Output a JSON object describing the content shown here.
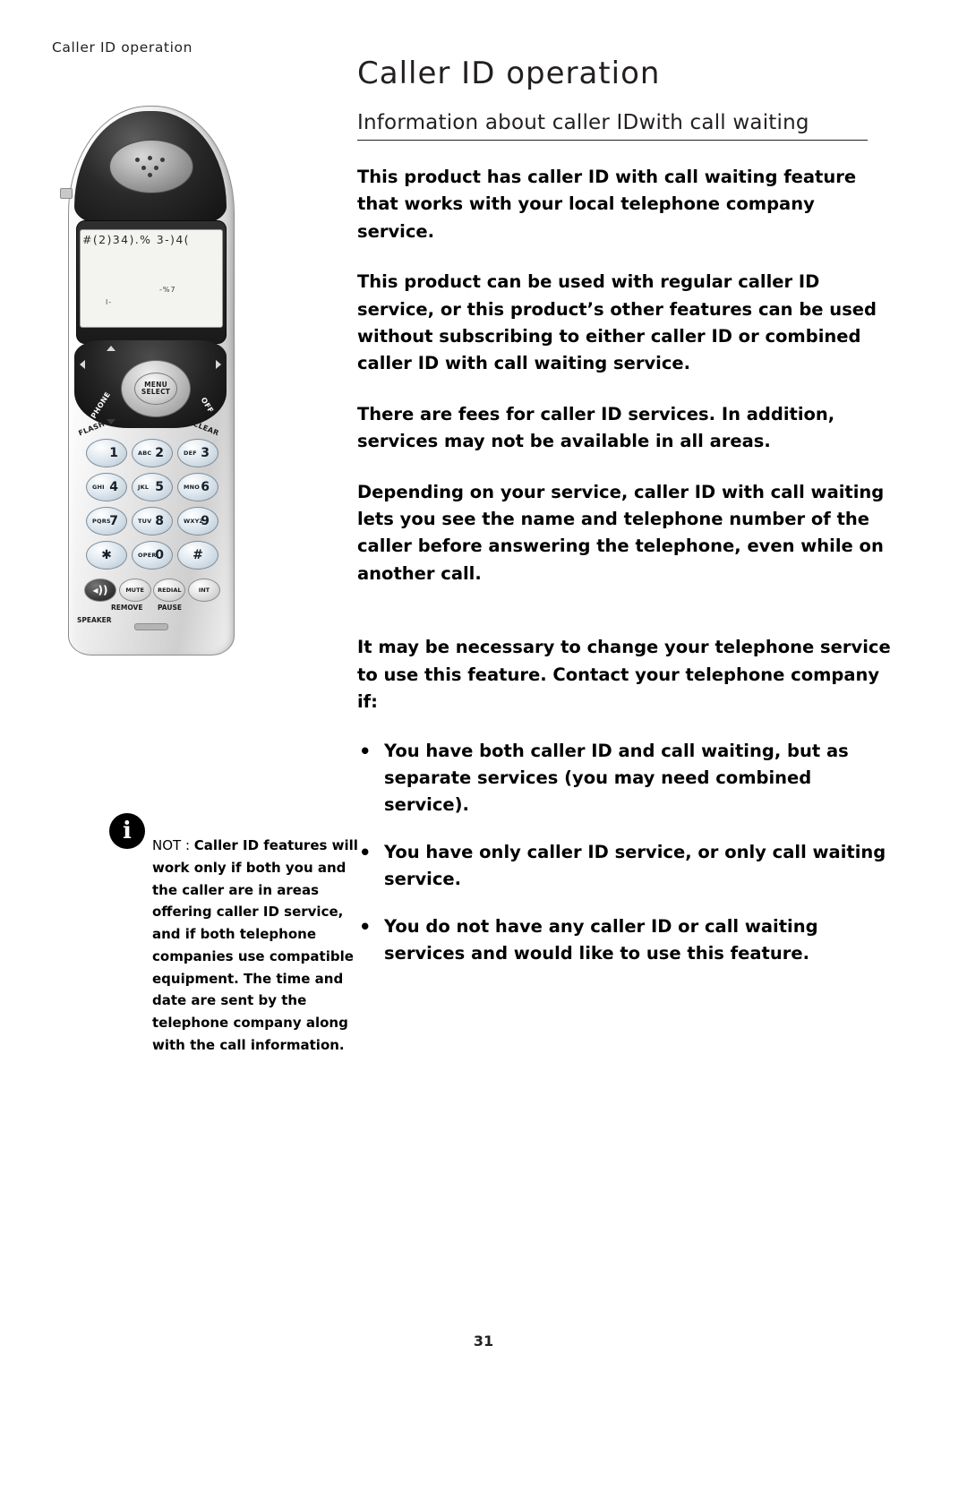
{
  "running_header": "Caller ID operation",
  "page_title": "Caller ID operation",
  "subtitle": {
    "part1": "Information about caller ID",
    "part2": "with call waiting"
  },
  "paragraphs": [
    "This product has caller ID with call waiting feature that works with your local telephone company service.",
    "This product can be used with regular caller ID service, or this product’s other features can be used without subscribing to either caller ID or combined caller ID with call waiting service.",
    "There are fees for caller ID services. In addition, services may not be available in all areas.",
    "Depending on your service, caller ID with call waiting lets you see the name and telephone number of the caller before answering the telephone, even while on another call.",
    "It may be necessary to change your telephone service to use this feature. Contact your telephone company if:"
  ],
  "bullets": [
    "You have both caller ID and call waiting, but as separate services (you may need combined service).",
    "You have only caller ID service, or only call waiting service.",
    "You do not have any caller ID or call waiting services and would like to use this feature."
  ],
  "note": {
    "icon": "i",
    "lead": "NOT",
    "colon": " : ",
    "text": "Caller ID features will work only if both you and the caller are in areas offering caller ID service, and if both telephone companies use compatible equipment. The time and date are sent by the telephone company along with the call information."
  },
  "handset": {
    "lcd_line1": "#(2)34).% 3-)4(",
    "lcd_line2": "-%7",
    "lcd_line3": "l-",
    "nav_center_line1": "MENU",
    "nav_center_line2": "SELECT",
    "label_phone": "PHONE",
    "label_off": "OFF",
    "label_flash": "FLASH",
    "label_clear": "CLEAR",
    "keys": [
      {
        "alpha": "",
        "num": "1"
      },
      {
        "alpha": "ABC",
        "num": "2"
      },
      {
        "alpha": "DEF",
        "num": "3"
      },
      {
        "alpha": "GHI",
        "num": "4"
      },
      {
        "alpha": "JKL",
        "num": "5"
      },
      {
        "alpha": "MNO",
        "num": "6"
      },
      {
        "alpha": "PQRS",
        "num": "7"
      },
      {
        "alpha": "TUV",
        "num": "8"
      },
      {
        "alpha": "WXYZ",
        "num": "9"
      },
      {
        "alpha": "",
        "num": "✱"
      },
      {
        "alpha": "OPER",
        "num": "0"
      },
      {
        "alpha": "",
        "num": "#"
      }
    ],
    "soft_keys": [
      "MUTE",
      "REDIAL",
      "INT"
    ],
    "speaker_glyph": "◂))",
    "caption_remove": "REMOVE",
    "caption_pause": "PAUSE",
    "caption_speaker": "SPEAKER"
  },
  "page_number": "31",
  "colors": {
    "text": "#000000",
    "heading": "#231f20",
    "key_face": "#dfe8ef"
  }
}
